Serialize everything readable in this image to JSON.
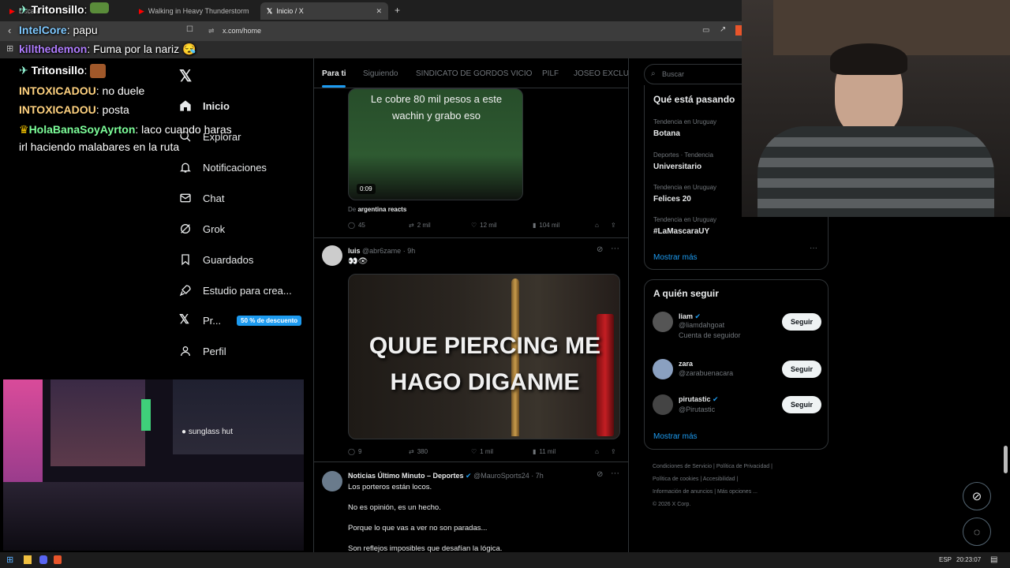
{
  "browser": {
    "tabs": [
      {
        "label": "Escala",
        "active": false
      },
      {
        "label": "Walking in Heavy Thunderstorm",
        "active": false
      },
      {
        "label": "Inicio / X",
        "active": true
      }
    ],
    "url": "x.com/home"
  },
  "chat": [
    {
      "user": "Tritonsillo",
      "text": ":",
      "color": "#ffffff"
    },
    {
      "user": "IntelCore",
      "text": ": papu",
      "color": "#7ec8ff"
    },
    {
      "user": "killthedemon",
      "text": ": Fuma por la nariz",
      "color": "#b07dff"
    },
    {
      "user": "Tritonsillo",
      "text": ":",
      "color": "#ffffff"
    },
    {
      "user": "INTOXICADOU",
      "text": ": no duele",
      "color": "#ffd27f"
    },
    {
      "user": "INTOXICADOU",
      "text": ": posta",
      "color": "#ffd27f"
    },
    {
      "user": "HolaBanaSoyAyrton",
      "text": ": laco cuando haras",
      "color": "#7dff9a"
    },
    {
      "user": "",
      "text": "irl haciendo malabares en la ruta",
      "color": "#ffffff"
    }
  ],
  "nav": {
    "items": [
      {
        "label": "Inicio",
        "icon": "home-icon"
      },
      {
        "label": "Explorar",
        "icon": "search-icon"
      },
      {
        "label": "Notificaciones",
        "icon": "bell-icon"
      },
      {
        "label": "Chat",
        "icon": "mail-icon"
      },
      {
        "label": "Grok",
        "icon": "grok-icon"
      },
      {
        "label": "Guardados",
        "icon": "bookmark-icon"
      },
      {
        "label": "Estudio para crea...",
        "icon": "rocket-icon"
      },
      {
        "label": "Pr...",
        "icon": "x-icon"
      },
      {
        "label": "Perfil",
        "icon": "person-icon"
      }
    ],
    "premium_badge": "50 % de descuento"
  },
  "feed": {
    "tabs": [
      "Para ti",
      "Siguiendo",
      "SINDICATO DE GORDOS VICIO",
      "PILF",
      "JOSEO EXCLUSI"
    ],
    "post1": {
      "caption": "Le cobre 80 mil pesos a este wachin y grabo eso",
      "duration": "0:09",
      "source_prefix": "De",
      "source": "argentina reacts",
      "replies": "45",
      "reposts": "2 mil",
      "likes": "12 mil",
      "views": "104 mil"
    },
    "post2": {
      "name": "luis",
      "handle": "@abr6zame",
      "time": "9h",
      "text": "👀👁",
      "image_text": "QUUE PIERCING ME HAGO DIGANME",
      "replies": "9",
      "reposts": "380",
      "likes": "1 mil",
      "views": "11 mil"
    },
    "post3": {
      "name": "Noticias Último Minuto – Deportes",
      "handle": "@MauroSports24",
      "time": "7h",
      "lines": [
        "Los porteros están locos.",
        "No es opinión, es un hecho.",
        "Porque lo que vas a ver no son paradas...",
        "Son reflejos imposibles que desafían la lógica."
      ]
    }
  },
  "sidebar": {
    "search_placeholder": "Buscar",
    "trends_title": "Qué está pasando",
    "trends": [
      {
        "context": "Tendencia en Uruguay",
        "name": "Botana"
      },
      {
        "context": "Deportes · Tendencia",
        "name": "Universitario"
      },
      {
        "context": "Tendencia en Uruguay",
        "name": "Felices 20"
      },
      {
        "context": "Tendencia en Uruguay",
        "name": "#LaMascaraUY"
      }
    ],
    "show_more": "Mostrar más",
    "follow_title": "A quién seguir",
    "follow": [
      {
        "name": "liam",
        "handle": "@liamdahgoat",
        "note": "Cuenta de seguidor",
        "button": "Seguir"
      },
      {
        "name": "zara",
        "handle": "@zarabuenacara",
        "note": "",
        "button": "Seguir"
      },
      {
        "name": "pirutastic",
        "handle": "@Pirutastic",
        "note": "",
        "button": "Seguir"
      }
    ],
    "footer": [
      "Condiciones de Servicio",
      "Política de Privacidad",
      "Política de cookies",
      "Accesibilidad",
      "Información de anuncios",
      "Más opciones ...",
      "© 2026 X Corp."
    ]
  },
  "stream_video": {
    "overlay_text": "sunglass hut"
  },
  "taskbar": {
    "lang": "ESP",
    "time": "20:23:07"
  }
}
